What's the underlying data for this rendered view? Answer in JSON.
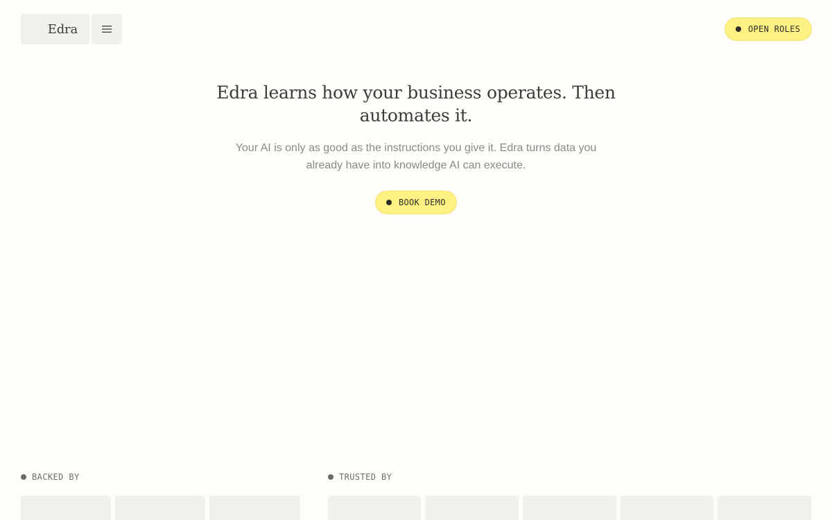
{
  "header": {
    "logo_text": "Edra",
    "menu_icon": "hamburger-menu-icon",
    "open_roles_label": "OPEN ROLES"
  },
  "hero": {
    "title": "Edra learns how your business operates. Then automates it.",
    "subtitle": "Your AI is only as good as the instructions you give it. Edra turns data you already have into knowledge AI can execute.",
    "cta_label": "BOOK DEMO"
  },
  "sections": {
    "backed_by_label": "BACKED BY",
    "trusted_by_label": "TRUSTED BY"
  },
  "colors": {
    "background": "#FEFDF9",
    "accent_pill": "#FCF182",
    "tile": "#F1F0EB",
    "text_dark": "#3d3d38",
    "text_muted": "#8a8a84"
  }
}
